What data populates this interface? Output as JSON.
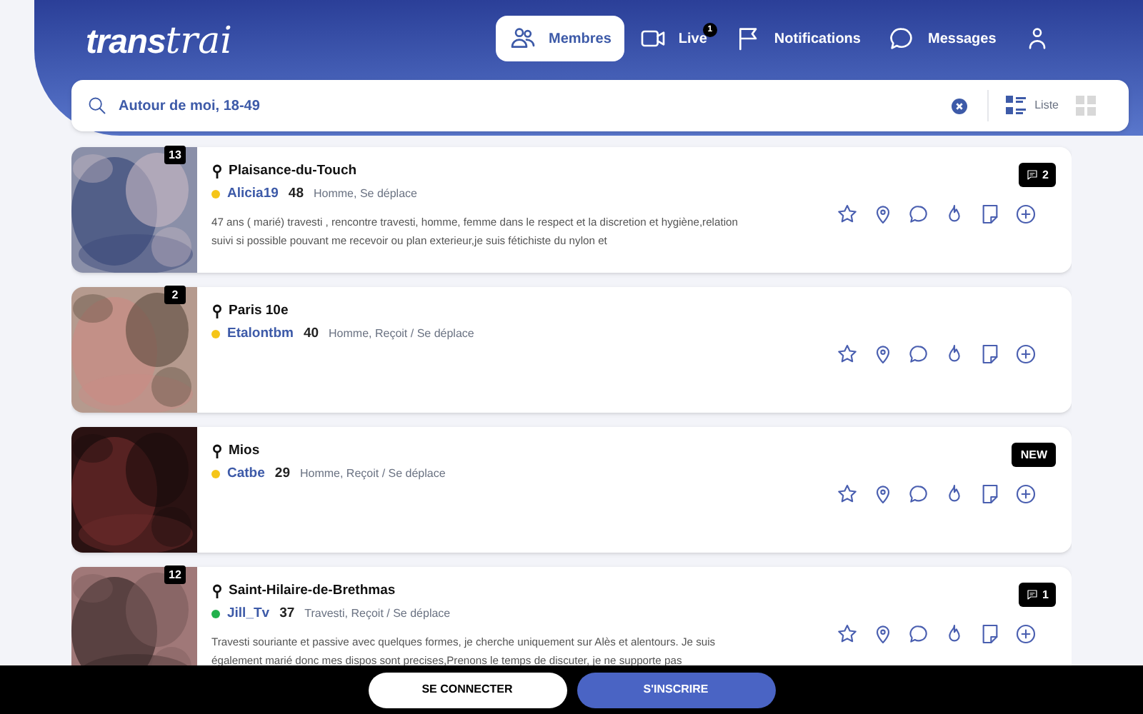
{
  "header": {
    "logo": {
      "bold": "trans",
      "script": "trai"
    },
    "nav": [
      {
        "kind": "members",
        "label": "Membres",
        "selected": true
      },
      {
        "kind": "video",
        "label": "Live",
        "selected": false,
        "count": "1"
      },
      {
        "kind": "flag",
        "label": "Notifications",
        "selected": false
      },
      {
        "kind": "chat",
        "label": "Messages",
        "selected": false
      },
      {
        "kind": "people",
        "selected": false
      }
    ]
  },
  "search": {
    "value": "Autour de moi, 18-49",
    "views": [
      {
        "kind": "list",
        "label": "Liste",
        "selected": true
      },
      {
        "kind": "grid",
        "selected": false
      }
    ]
  },
  "profiles": [
    {
      "kind": "picture",
      "photos": "13",
      "city": "Plaisance-du-Touch",
      "name": "Alicia19",
      "color": "#f5c518",
      "age": "48",
      "tags": "Homme, Se déplace",
      "description": "47 ans ( marié) travesti , rencontre travesti, homme, femme dans le respect et la discretion et hygiène,relation suivi si possible pouvant me recevoir ou plan exterieur,je suis fétichiste du nylon et",
      "badge": {
        "kind": "comments",
        "text": "2"
      }
    },
    {
      "kind": "picture",
      "photos": "2",
      "city": "Paris 10e",
      "name": "Etalontbm",
      "color": "#f5c518",
      "age": "40",
      "tags": "Homme, Reçoit / Se déplace"
    },
    {
      "kind": "picture",
      "city": "Mios",
      "name": "Catbe",
      "color": "#f5c518",
      "age": "29",
      "tags": "Homme, Reçoit / Se déplace",
      "badge": {
        "kind": "new",
        "text": "NEW"
      }
    },
    {
      "kind": "picture",
      "photos": "12",
      "city": "Saint-Hilaire-de-Brethmas",
      "name": "Jill_Tv",
      "color": "#22b14c",
      "age": "37",
      "tags": "Travesti, Reçoit / Se déplace",
      "description": "Travesti souriante et passive avec quelques formes, je cherche uniquement sur Alès et alentours. Je suis également marié donc mes dispos sont precises,Prenons le temps de discuter, je ne supporte pas",
      "badge": {
        "kind": "comments",
        "text": "1"
      }
    }
  ],
  "footer": {
    "buttons": [
      {
        "kind": "login",
        "label": "SE CONNECTER"
      },
      {
        "kind": "signup",
        "label": "S'INSCRIRE"
      }
    ]
  }
}
